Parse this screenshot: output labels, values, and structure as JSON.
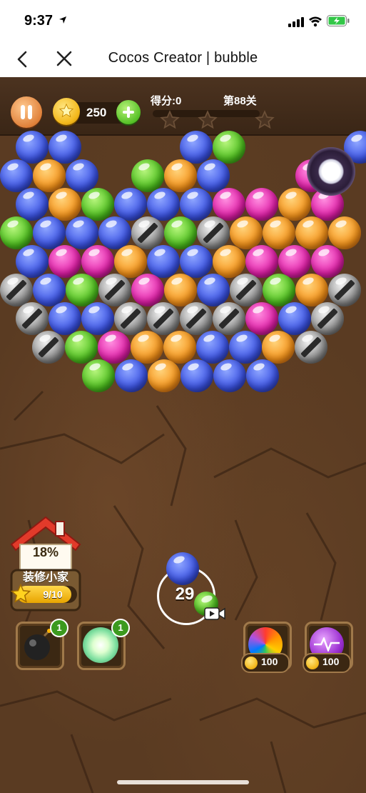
{
  "status_bar": {
    "time": "9:37"
  },
  "nav": {
    "title": "Cocos Creator | bubble"
  },
  "hud": {
    "coins": "250",
    "score_label": "得分:0",
    "level_label": "第88关"
  },
  "house": {
    "percent": "18%",
    "name": "装修小家",
    "progress": "9/10",
    "progress_value": 0.9
  },
  "shooter": {
    "shots_left": "29",
    "current_bubble": "blue",
    "next_bubble": "green"
  },
  "boosters": {
    "bomb": {
      "count": "1"
    },
    "light_ball": {
      "count": "1"
    },
    "rainbow": {
      "price": "100"
    },
    "lightning": {
      "price": "100"
    }
  },
  "colors": {
    "blue": "#3c54e6",
    "orange": "#f7941a",
    "green": "#4fc21f",
    "pink": "#e31fa9",
    "metal": "#9a9a9a",
    "board": "#5a3b22"
  },
  "board_rows": [
    [
      "blue",
      "blue",
      "_",
      "_",
      "_",
      "blue",
      "green",
      "_",
      "_",
      "_",
      "blue",
      "pink"
    ],
    [
      "blue",
      "orange",
      "blue",
      "_",
      "green",
      "orange",
      "blue",
      "_",
      "_",
      "pink",
      "_",
      "_"
    ],
    [
      "blue",
      "orange",
      "green",
      "blue",
      "blue",
      "blue",
      "pink",
      "pink",
      "orange",
      "pink"
    ],
    [
      "green",
      "blue",
      "blue",
      "blue",
      "metal",
      "green",
      "metal",
      "orange",
      "orange",
      "orange",
      "orange"
    ],
    [
      "blue",
      "pink",
      "pink",
      "orange",
      "blue",
      "blue",
      "orange",
      "pink",
      "pink",
      "pink"
    ],
    [
      "metal",
      "blue",
      "green",
      "metal",
      "pink",
      "orange",
      "blue",
      "metal",
      "green",
      "orange",
      "metal"
    ],
    [
      "metal",
      "blue",
      "blue",
      "metal",
      "metal",
      "metal",
      "metal",
      "pink",
      "blue",
      "metal"
    ],
    [
      "metal",
      "green",
      "pink",
      "orange",
      "orange",
      "blue",
      "blue",
      "orange",
      "metal"
    ],
    [
      "green",
      "blue",
      "orange",
      "blue",
      "blue",
      "blue"
    ]
  ]
}
